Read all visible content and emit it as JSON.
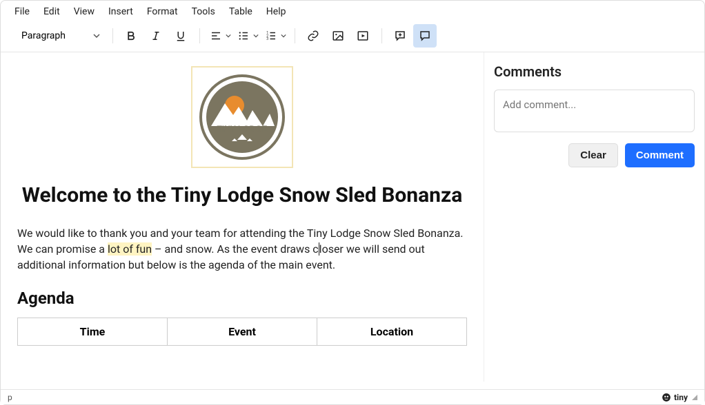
{
  "menubar": [
    "File",
    "Edit",
    "View",
    "Insert",
    "Format",
    "Tools",
    "Table",
    "Help"
  ],
  "toolbar": {
    "format_select": "Paragraph"
  },
  "document": {
    "logo_text": "TINY LODGE",
    "title": "Welcome to the Tiny Lodge Snow Sled Bonanza",
    "paragraph_pre": "We would like to thank you and your team for attending the Tiny Lodge Snow Sled Bonanza. We can promise a ",
    "paragraph_highlight": "lot of fun",
    "paragraph_mid": " – and snow. As the event draws c",
    "paragraph_post": "loser we will send out additional information but below is the agenda of the main event.",
    "agenda_heading": "Agenda",
    "table_headers": [
      "Time",
      "Event",
      "Location"
    ]
  },
  "sidebar": {
    "title": "Comments",
    "placeholder": "Add comment...",
    "clear_label": "Clear",
    "comment_label": "Comment"
  },
  "statusbar": {
    "path": "p",
    "branding": "tiny"
  }
}
